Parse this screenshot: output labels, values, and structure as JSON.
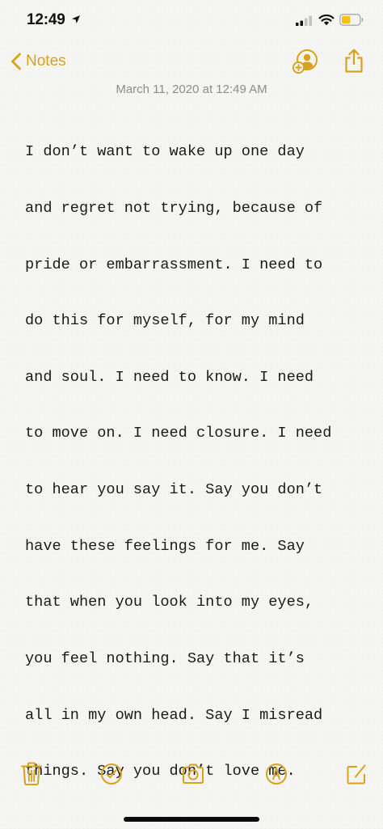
{
  "status_bar": {
    "time": "12:49",
    "icons": [
      "location-arrow-icon",
      "cellular-signal-icon",
      "wifi-icon",
      "battery-low-power-icon"
    ]
  },
  "nav": {
    "back_label": "Notes",
    "accent_color": "#d9a21b"
  },
  "note": {
    "date": "March 11, 2020 at 12:49 AM",
    "lines": [
      "I don’t want to wake up one day",
      "and regret not trying, because of",
      "pride or embarrassment. I need to",
      "do this for myself, for my mind",
      "and soul. I need to know. I need",
      "to move on. I need closure. I need",
      "to hear you say it. Say you don’t",
      "have these feelings for me. Say",
      "that when you look into my eyes,",
      "you feel nothing. Say that it’s",
      "all in my own head. Say I misread",
      "things. Say you don’t love me."
    ]
  },
  "toolbar": {
    "icons": [
      "trash-icon",
      "checklist-icon",
      "camera-icon",
      "markup-icon",
      "compose-icon"
    ]
  }
}
